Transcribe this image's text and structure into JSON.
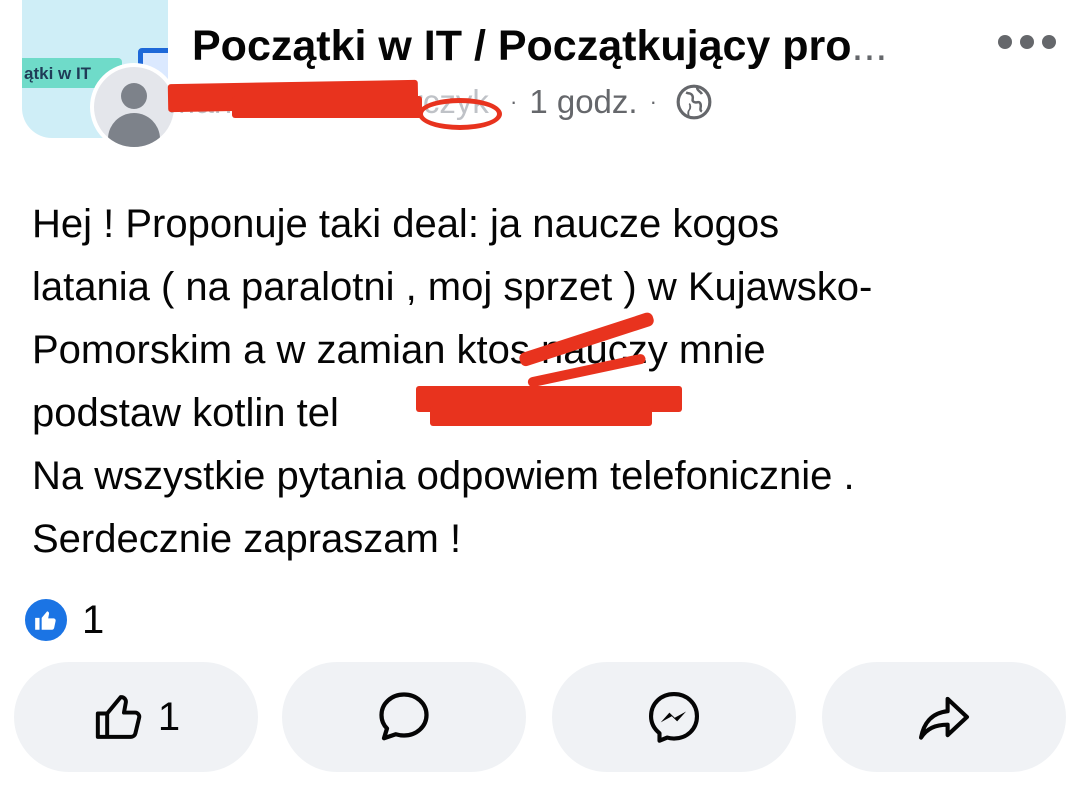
{
  "header": {
    "group_name": "Początki w IT / Początkujący pro",
    "group_name_ellipsis": "...",
    "group_thumb_text": "ątki w IT",
    "author_name": "Mariusz Kaczmarczyk",
    "time": "1 godz.",
    "separator": "·",
    "audience_icon": "globe-icon",
    "menu_icon": "more-horizontal-icon"
  },
  "post": {
    "lines": [
      "Hej ! Proponuje taki deal: ja naucze kogos",
      "latania ( na paralotni , moj sprzet ) w Kujawsko-",
      "Pomorskim a w zamian ktos nauczy mnie",
      "podstaw kotlin tel ",
      "Na wszystkie pytania odpowiem telefonicznie .",
      "Serdecznie zapraszam !"
    ]
  },
  "reactions": {
    "icon": "like-reaction-icon",
    "count": "1"
  },
  "actions": {
    "like": {
      "icon": "thumbs-up-icon",
      "count": "1"
    },
    "comment": {
      "icon": "comment-icon"
    },
    "send": {
      "icon": "messenger-icon"
    },
    "share": {
      "icon": "share-icon"
    }
  },
  "colors": {
    "redaction": "#e8331e",
    "like_blue": "#1b74e4",
    "button_bg": "#f0f2f5",
    "secondary_text": "#65676b"
  }
}
